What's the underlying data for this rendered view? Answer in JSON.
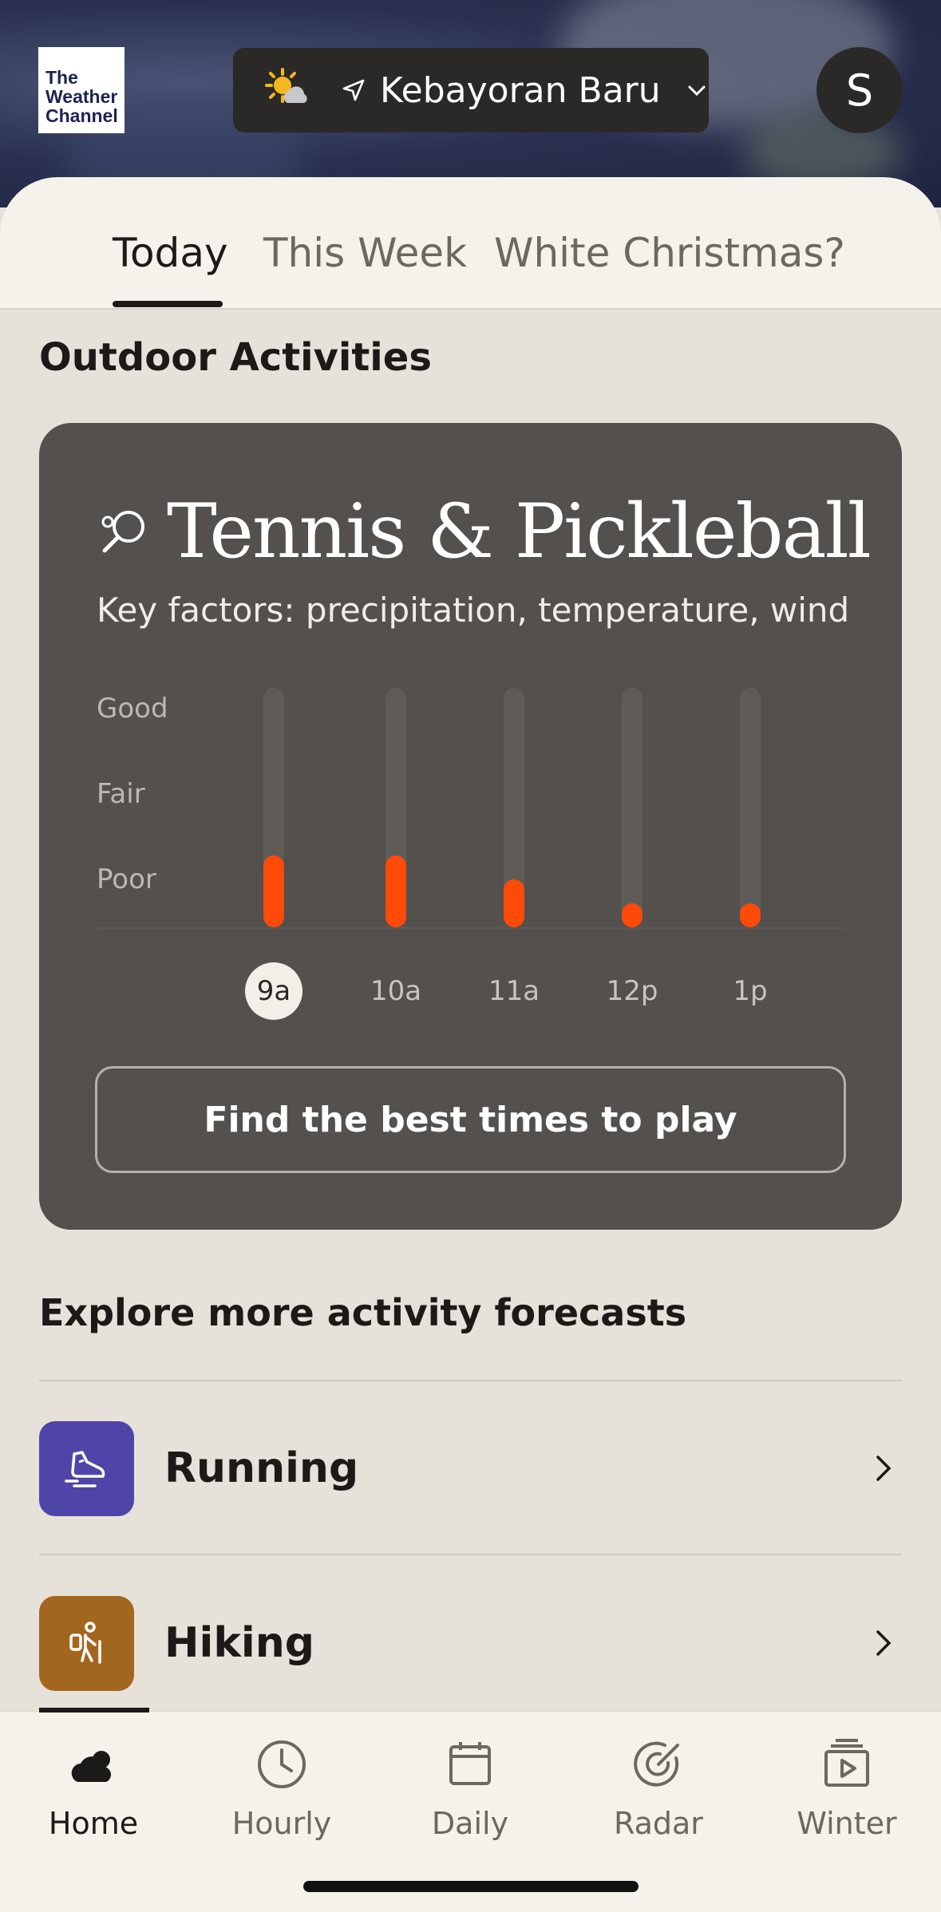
{
  "header": {
    "logo_lines": [
      "The",
      "Weather",
      "Channel"
    ],
    "location": "Kebayoran Baru",
    "avatar_initial": "S"
  },
  "tabs": [
    {
      "label": "Today",
      "active": true
    },
    {
      "label": "This Week",
      "active": false
    },
    {
      "label": "White Christmas?",
      "active": false
    }
  ],
  "outdoor": {
    "section_title": "Outdoor Activities",
    "card": {
      "title": "Tennis & Pickleball",
      "subtitle": "Key factors: precipitation, temperature, wind",
      "scale": [
        "Good",
        "Fair",
        "Poor"
      ],
      "hours": [
        {
          "label": "9a",
          "level": 0.3,
          "selected": true
        },
        {
          "label": "10a",
          "level": 0.3,
          "selected": false
        },
        {
          "label": "11a",
          "level": 0.2,
          "selected": false
        },
        {
          "label": "12p",
          "level": 0.1,
          "selected": false
        },
        {
          "label": "1p",
          "level": 0.1,
          "selected": false
        }
      ],
      "button_label": "Find the best times to play",
      "bar_color": "#ff4a08"
    }
  },
  "explore": {
    "title": "Explore more activity forecasts",
    "items": [
      {
        "label": "Running",
        "icon": "running-shoe-icon",
        "color": "#4f44a8"
      },
      {
        "label": "Hiking",
        "icon": "hiker-icon",
        "color": "#a3661f"
      }
    ]
  },
  "nav": [
    {
      "label": "Home",
      "icon": "cloud-icon",
      "active": true
    },
    {
      "label": "Hourly",
      "icon": "clock-icon",
      "active": false
    },
    {
      "label": "Daily",
      "icon": "calendar-icon",
      "active": false
    },
    {
      "label": "Radar",
      "icon": "radar-icon",
      "active": false
    },
    {
      "label": "Winter",
      "icon": "video-icon",
      "active": false
    }
  ]
}
